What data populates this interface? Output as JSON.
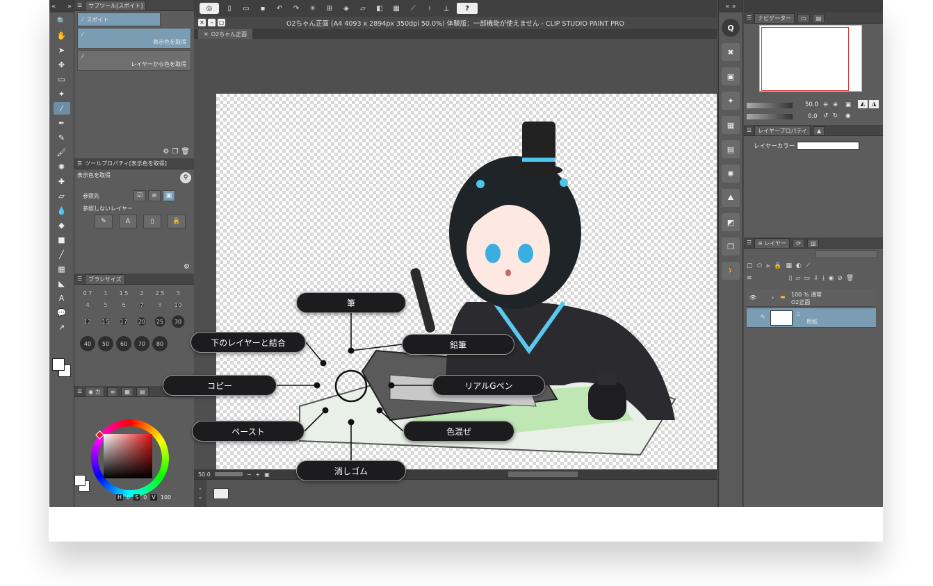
{
  "left_panel": {
    "subtool_tab": "サブツール[スポイト]",
    "subtool_group": "スポイト",
    "subtool_items": [
      "表示色を取得",
      "レイヤーから色を取得"
    ],
    "toolprop_tab": "ツールプロパティ[表示色を取得]",
    "toolprop_name": "表示色を取得",
    "ref_source_label": "参照先",
    "no_ref_layer_label": "参照しないレイヤー",
    "brushsize_tab": "ブラシサイズ",
    "brush_sizes_row1": [
      "0.7",
      "1",
      "1.5",
      "2",
      "2.5",
      "3"
    ],
    "brush_sizes_row2": [
      "4",
      "5",
      "6",
      "7",
      "8",
      "10"
    ],
    "brush_sizes_row3": [
      "12",
      "15",
      "17",
      "20",
      "25",
      "30"
    ],
    "brush_sizes_row4": [
      "40",
      "50",
      "60",
      "70",
      "80",
      ""
    ],
    "color_tab": "カ",
    "color_readout": {
      "h": "0",
      "s": "0",
      "v": "100"
    }
  },
  "toolbar": {
    "help_label": "?"
  },
  "window": {
    "title": "O2ちゃん正面 (A4 4093 x 2894px 350dpi 50.0%)  体験版：一部機能が使えません - CLIP STUDIO PAINT PRO",
    "doc_tab": "O2ちゃん正面"
  },
  "status": {
    "zoom": "50.0"
  },
  "navigator": {
    "tab": "ナビゲーター",
    "zoom_value": "50.0",
    "rotate_value": "0.0"
  },
  "layer_property": {
    "tab": "レイヤープロパティ",
    "layer_color_label": "レイヤーカラー"
  },
  "layers": {
    "tab": "レイヤー",
    "folder_blend": "100 % 通常",
    "folder_name": "O2正面",
    "paper_name": "用紙"
  },
  "callouts": {
    "fude": "筆",
    "enpitsu": "鉛筆",
    "shita_merge": "下のレイヤーと結合",
    "copy": "コピー",
    "real_g_pen": "リアルGペン",
    "paste": "ペースト",
    "iromaze": "色混ぜ",
    "eraser": "消しゴム"
  },
  "colors": {
    "accent": "#7a9db3",
    "callout_bg": "#1c1c1e"
  }
}
